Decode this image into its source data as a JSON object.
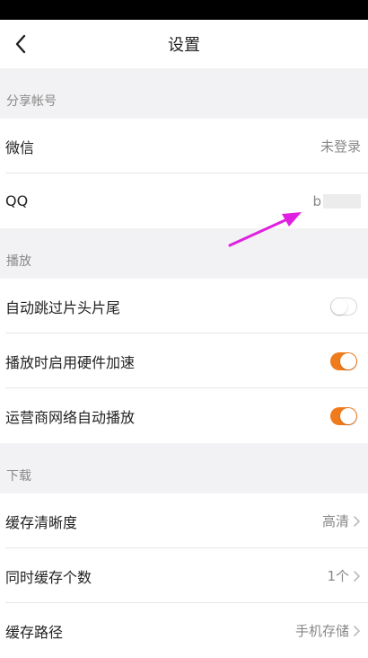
{
  "nav": {
    "title": "设置"
  },
  "sections": {
    "share": {
      "header": "分享帐号",
      "wechat": {
        "label": "微信",
        "value": "未登录"
      },
      "qq": {
        "label": "QQ",
        "value": "b"
      }
    },
    "play": {
      "header": "播放",
      "skip": {
        "label": "自动跳过片头片尾",
        "toggle": "off"
      },
      "hw": {
        "label": "播放时启用硬件加速",
        "toggle": "on"
      },
      "carrier": {
        "label": "运营商网络自动播放",
        "toggle": "on"
      }
    },
    "download": {
      "header": "下载",
      "quality": {
        "label": "缓存清晰度",
        "value": "高清"
      },
      "count": {
        "label": "同时缓存个数",
        "value": "1个"
      },
      "path": {
        "label": "缓存路径",
        "value": "手机存储"
      }
    }
  },
  "colors": {
    "accent": "#f07b1c",
    "annotation": "#e020e0"
  }
}
